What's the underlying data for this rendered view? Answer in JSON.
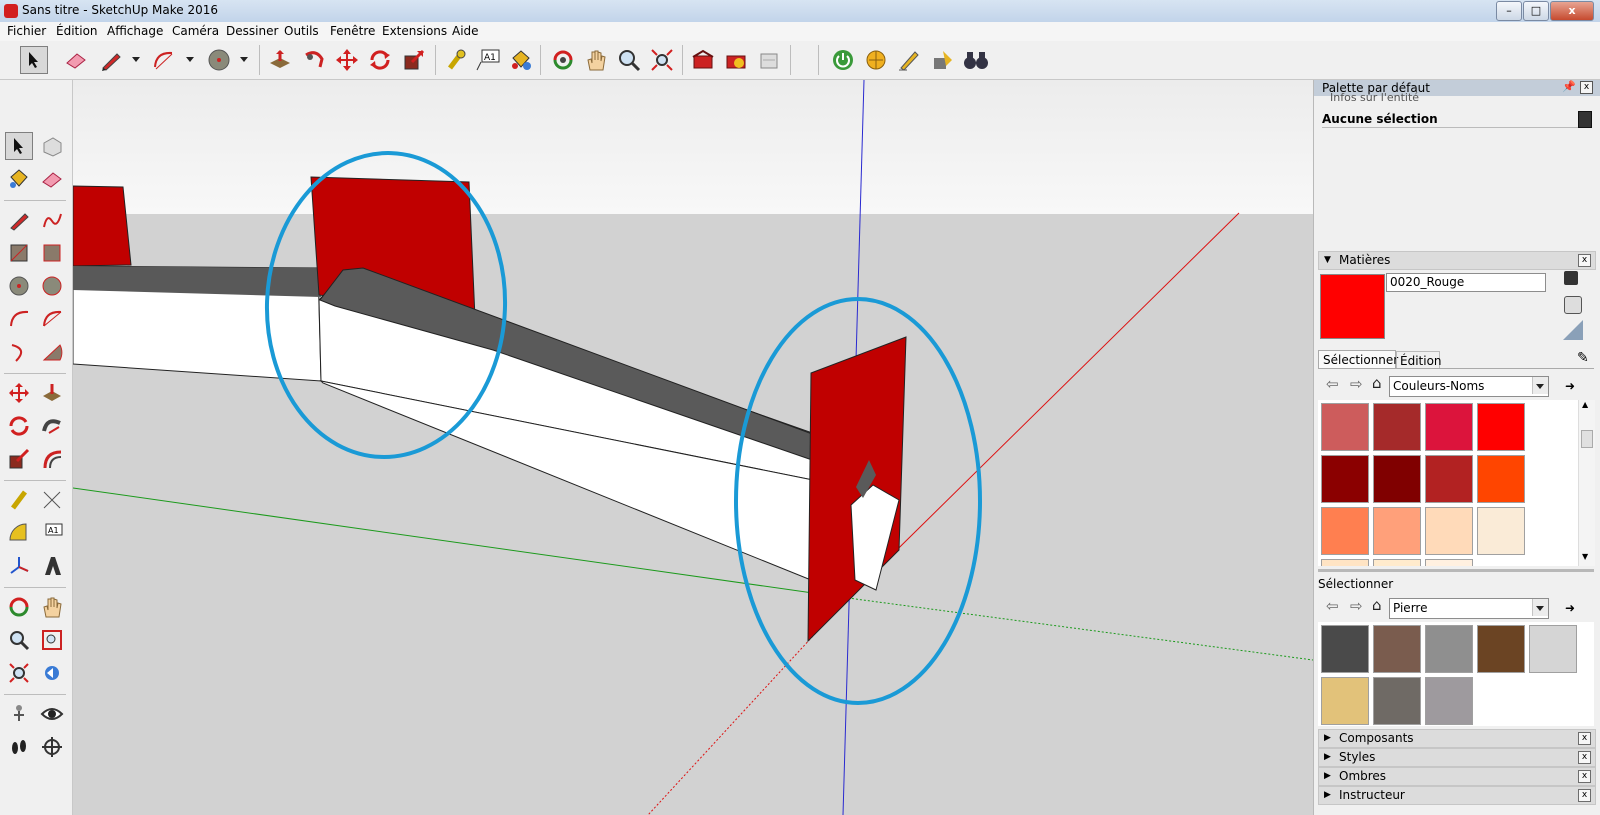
{
  "window": {
    "title": "Sans titre - SketchUp Make 2016",
    "minimize": "–",
    "maximize": "□",
    "close": "x"
  },
  "menu": [
    {
      "label": "Fichier"
    },
    {
      "label": "Édition"
    },
    {
      "label": "Affichage"
    },
    {
      "label": "Caméra"
    },
    {
      "label": "Dessiner"
    },
    {
      "label": "Outils"
    },
    {
      "label": "Fenêtre"
    },
    {
      "label": "Extensions"
    },
    {
      "label": "Aide"
    }
  ],
  "toolbar": {
    "text_label": "A1"
  },
  "left_toolbar": {
    "text_label": "A1"
  },
  "panel": {
    "title": "Palette par défaut",
    "entity_info_label": "Infos sur l'entité",
    "entity_selection": "Aucune sélection",
    "materials": {
      "header": "Matières",
      "current_name": "0020_Rouge",
      "current_color": "#ff0000",
      "tabs": [
        "Sélectionner",
        "Édition"
      ],
      "collection": "Couleurs-Noms",
      "colors": [
        "#cd5c5c",
        "#a52a2a",
        "#dc143c",
        "#ff0000",
        "#8b0000",
        "#800000",
        "#b22222",
        "#ff4500",
        "#ff7f50",
        "#ffa07a",
        "#ffdab9",
        "#faebd7",
        "#ffe4c4",
        "#ffebcd",
        "#fff0e0"
      ]
    },
    "secondary": {
      "label": "Sélectionner",
      "collection": "Pierre",
      "textures": [
        "#4a4a4a",
        "#7a5c4e",
        "#8f8f8f",
        "#6b4423",
        "#d5d5d5",
        "#e2c27a",
        "#6f6a65",
        "#9e9a9e"
      ]
    },
    "collapsed_sections": [
      "Composants",
      "Styles",
      "Ombres",
      "Instructeur"
    ]
  },
  "viewport": {
    "highlight_color": "#1a9ad6",
    "model_red": "#c00000"
  }
}
